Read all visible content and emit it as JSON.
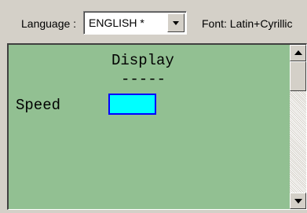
{
  "toolbar": {
    "language_label": "Language :",
    "language_value": "ENGLISH *",
    "font_label": "Font: Latin+Cyrillic"
  },
  "display": {
    "title": "Display",
    "separator": "-----",
    "speed_label": "Speed"
  },
  "colors": {
    "display_background": "#92c092",
    "speed_field_fill": "#00ffff",
    "speed_field_border": "#0000ff"
  }
}
